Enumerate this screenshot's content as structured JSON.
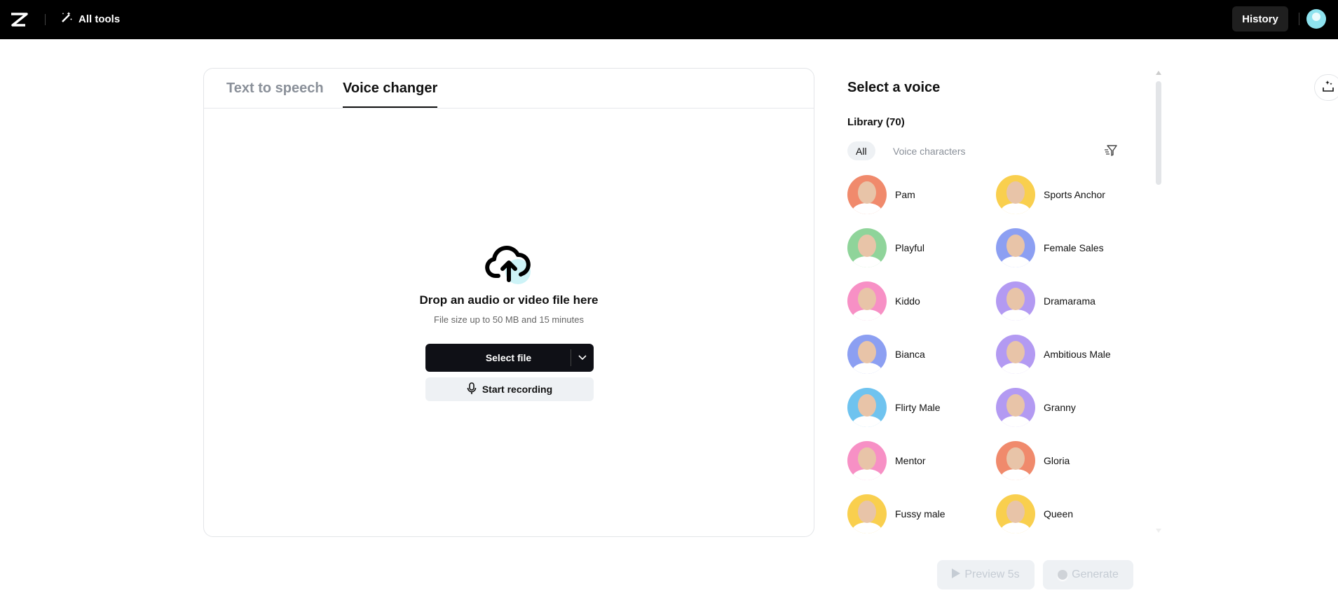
{
  "topbar": {
    "all_tools": "All tools",
    "history": "History"
  },
  "tabs": [
    {
      "label": "Text to speech",
      "active": false
    },
    {
      "label": "Voice changer",
      "active": true
    }
  ],
  "upload": {
    "title": "Drop an audio or video file here",
    "subtitle": "File size up to 50 MB and 15 minutes",
    "select_file": "Select file",
    "start_recording": "Start recording"
  },
  "panel": {
    "title": "Select a voice",
    "library": "Library (70)",
    "chips": [
      "All",
      "Voice characters"
    ]
  },
  "voices": [
    {
      "name": "Pam",
      "color": "#f08a6c"
    },
    {
      "name": "Sports Anchor",
      "color": "#f9cf4e"
    },
    {
      "name": "Playful",
      "color": "#8fd49a"
    },
    {
      "name": "Female Sales",
      "color": "#8c9ff2"
    },
    {
      "name": "Kiddo",
      "color": "#f790c5"
    },
    {
      "name": "Dramarama",
      "color": "#b39af2"
    },
    {
      "name": "Bianca",
      "color": "#8c9ff2"
    },
    {
      "name": "Ambitious Male",
      "color": "#b39af2"
    },
    {
      "name": "Flirty Male",
      "color": "#6fc3ef"
    },
    {
      "name": "Granny",
      "color": "#b39af2"
    },
    {
      "name": "Mentor",
      "color": "#f790c5"
    },
    {
      "name": "Gloria",
      "color": "#f08a6c"
    },
    {
      "name": "Fussy male",
      "color": "#f9cf4e"
    },
    {
      "name": "Queen",
      "color": "#f9cf4e"
    }
  ],
  "footer": {
    "preview": "Preview 5s",
    "generate": "Generate"
  }
}
